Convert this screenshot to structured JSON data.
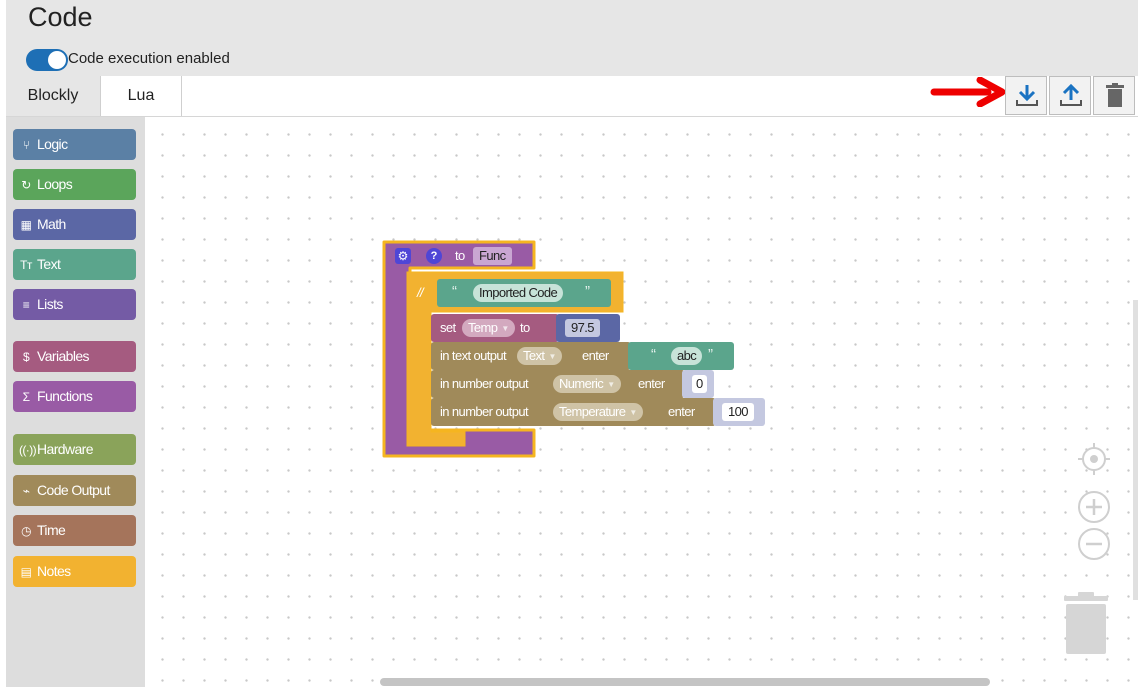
{
  "page": {
    "title": "Code",
    "toggle_label": "Code execution enabled",
    "toggle_on": true
  },
  "tabs": [
    {
      "label": "Blockly",
      "active": true
    },
    {
      "label": "Lua",
      "active": false
    }
  ],
  "toolbar": {
    "download_icon": "download-icon",
    "upload_icon": "upload-icon",
    "trash_icon": "trash-icon",
    "arrow_color": "#ee0000"
  },
  "toolbox": [
    {
      "icon": "⑂",
      "label": "Logic",
      "color": "#5b80a5"
    },
    {
      "icon": "↻",
      "label": "Loops",
      "color": "#5ba55b"
    },
    {
      "icon": "▦",
      "label": "Math",
      "color": "#5b67a5"
    },
    {
      "icon": "Tт",
      "label": "Text",
      "color": "#5ba58c"
    },
    {
      "icon": "≡",
      "label": "Lists",
      "color": "#745ba5"
    },
    {
      "icon": "$",
      "label": "Variables",
      "color": "#a55b80"
    },
    {
      "icon": "Σ",
      "label": "Functions",
      "color": "#995ba5"
    },
    {
      "icon": "((·))",
      "label": "Hardware",
      "color": "#8aa35a"
    },
    {
      "icon": "⌁",
      "label": "Code Output",
      "color": "#a08a5a"
    },
    {
      "icon": "◷",
      "label": "Time",
      "color": "#a5745b"
    },
    {
      "icon": "▤",
      "label": "Notes",
      "color": "#f2b230"
    }
  ],
  "blocks": {
    "func": {
      "prefix": "to",
      "name": "Func"
    },
    "comment": {
      "marker": "//",
      "open_quote": "“",
      "text": "Imported Code",
      "close_quote": "”"
    },
    "set_var": {
      "label_set": "set",
      "variable": "Temp",
      "label_to": "to",
      "value": "97.5"
    },
    "text_output": {
      "label": "in text output",
      "target": "Text",
      "enter": "enter",
      "open_quote": "“",
      "value": "abc",
      "close_quote": "”"
    },
    "num_output_1": {
      "label": "in number output",
      "target": "Numeric",
      "enter": "enter",
      "value": "0"
    },
    "num_output_2": {
      "label": "in number output",
      "target": "Temperature",
      "enter": "enter",
      "value": "100"
    }
  },
  "colors": {
    "procedure": "#995ba5",
    "selection_outline": "#f5b520",
    "variable": "#a55b80",
    "math": "#5b67a5",
    "text": "#5ba58c",
    "output": "#a08a5a",
    "comment": "#f2b230"
  }
}
